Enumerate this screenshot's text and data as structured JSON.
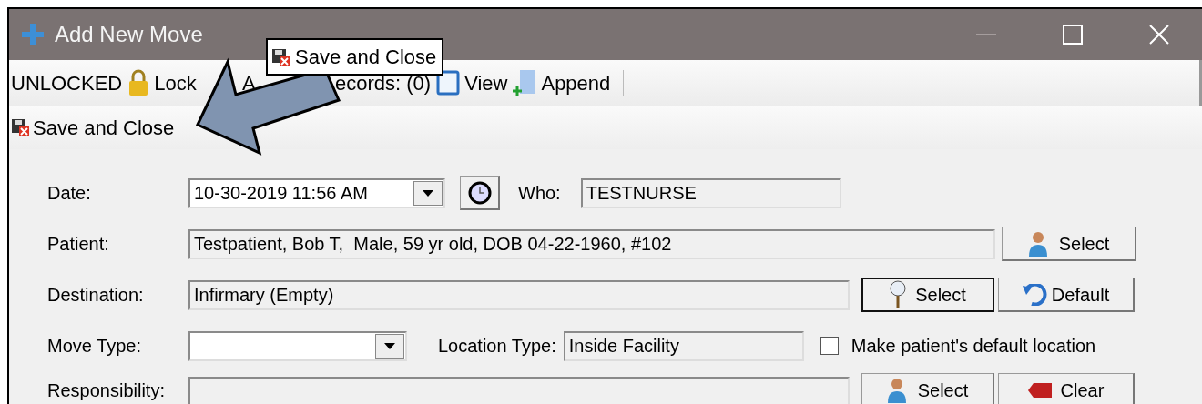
{
  "window": {
    "title": "Add New Move",
    "controls": [
      {
        "kind": "minimize",
        "disabled": true
      },
      {
        "kind": "maximize",
        "disabled": false
      },
      {
        "kind": "close",
        "disabled": false
      }
    ]
  },
  "toolbar": [
    {
      "kind": "label",
      "text": "UNLOCKED"
    },
    {
      "kind": "lock",
      "text": "Lock"
    },
    {
      "kind": "fragment",
      "text": "A"
    },
    {
      "kind": "fragment",
      "text": "ecords: (0)"
    },
    {
      "kind": "view",
      "text": "View"
    },
    {
      "kind": "append",
      "text": "Append"
    }
  ],
  "action_bar": {
    "text": "Save and Close"
  },
  "tooltip": {
    "text": "Save and Close"
  },
  "form": {
    "date": {
      "label": "Date:",
      "value": "10-30-2019 11:56 AM"
    },
    "who": {
      "label": "Who:",
      "value": "TESTNURSE"
    },
    "patient": {
      "label": "Patient:",
      "value": "Testpatient, Bob T,  Male, 59 yr old, DOB 04-22-1960, #102",
      "button": "Select"
    },
    "destination": {
      "label": "Destination:",
      "value": "Infirmary (Empty)",
      "buttons": [
        "Select",
        "Default"
      ]
    },
    "move_type": {
      "label": "Move Type:"
    },
    "location_type": {
      "label": "Location Type:",
      "value": "Inside Facility"
    },
    "default_location": {
      "label": "Make patient's default location",
      "checked": false
    },
    "responsibility": {
      "label": "Responsibility:",
      "buttons": [
        "Select",
        "Clear"
      ]
    }
  }
}
